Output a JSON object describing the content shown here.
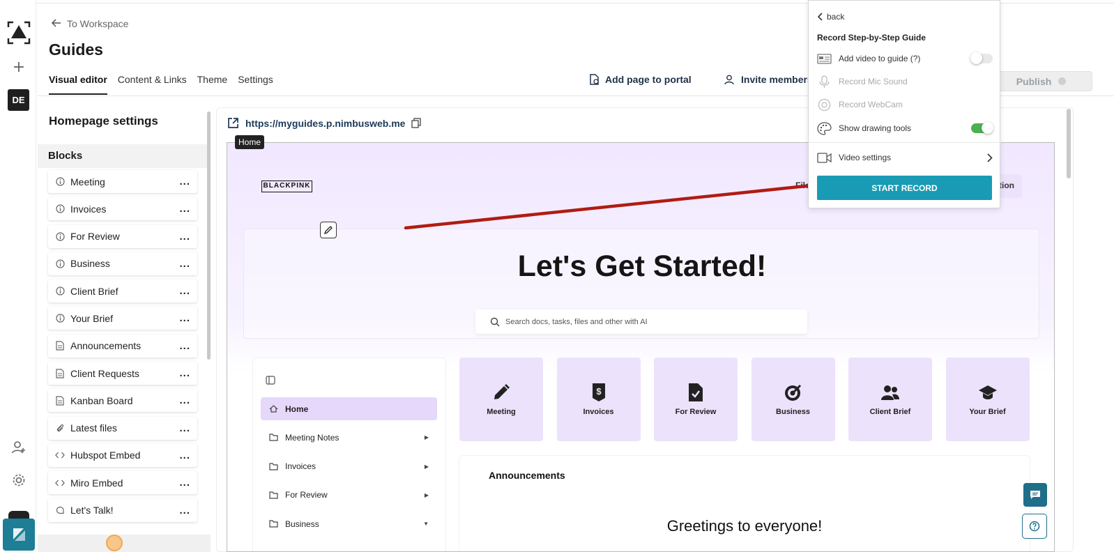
{
  "header": {
    "back_label": "To Workspace",
    "title": "Guides",
    "tabs": [
      {
        "label": "Visual editor",
        "active": true
      },
      {
        "label": "Content & Links",
        "active": false
      },
      {
        "label": "Theme",
        "active": false
      },
      {
        "label": "Settings",
        "active": false
      }
    ],
    "add_page_label": "Add page to portal",
    "invite_label": "Invite members",
    "publish_label": "Publish"
  },
  "rail": {
    "avatar_initials": "DE",
    "plus_symbol": "+",
    "icons": [
      "logo-icon",
      "add-icon",
      "invite-user-icon",
      "settings-gear-icon",
      "app-switch-icon"
    ]
  },
  "settings_panel": {
    "title": "Homepage settings",
    "blocks_label": "Blocks",
    "more_symbol": "...",
    "blocks": [
      {
        "label": "Meeting",
        "icon": "info-icon"
      },
      {
        "label": "Invoices",
        "icon": "info-icon"
      },
      {
        "label": "For Review",
        "icon": "info-icon"
      },
      {
        "label": "Business",
        "icon": "info-icon"
      },
      {
        "label": "Client Brief",
        "icon": "info-icon"
      },
      {
        "label": "Your Brief",
        "icon": "info-icon"
      },
      {
        "label": "Announcements",
        "icon": "document-icon"
      },
      {
        "label": "Client Requests",
        "icon": "document-icon"
      },
      {
        "label": "Kanban Board",
        "icon": "document-icon"
      },
      {
        "label": "Latest files",
        "icon": "paperclip-icon"
      },
      {
        "label": "Hubspot Embed",
        "icon": "code-icon"
      },
      {
        "label": "Miro Embed",
        "icon": "code-icon"
      },
      {
        "label": "Let's Talk!",
        "icon": "chat-icon"
      }
    ]
  },
  "preview": {
    "url": "https://myguides.p.nimbusweb.me",
    "home_tooltip": "Home",
    "logo_text": "BLACKPINK",
    "nav_peek_files": "File",
    "nav_peek_other": "tion",
    "hero_title": "Let's Get Started!",
    "search_placeholder": "Search docs, tasks, files and other with AI",
    "nav_items": [
      {
        "label": "Home",
        "active": true,
        "caret": ""
      },
      {
        "label": "Meeting Notes",
        "active": false,
        "caret": "▶"
      },
      {
        "label": "Invoices",
        "active": false,
        "caret": "▶"
      },
      {
        "label": "For Review",
        "active": false,
        "caret": "▶"
      },
      {
        "label": "Business",
        "active": false,
        "caret": "▼"
      }
    ],
    "tiles": [
      {
        "label": "Meeting",
        "icon": "pencil-icon"
      },
      {
        "label": "Invoices",
        "icon": "dollar-file-icon"
      },
      {
        "label": "For Review",
        "icon": "file-check-icon"
      },
      {
        "label": "Business",
        "icon": "target-icon"
      },
      {
        "label": "Client Brief",
        "icon": "users-icon"
      },
      {
        "label": "Your Brief",
        "icon": "graduation-cap-icon"
      }
    ],
    "announcements_title": "Announcements",
    "greeting": "Greetings to everyone!"
  },
  "recorder": {
    "back_label": "back",
    "title": "Record Step-by-Step Guide",
    "options": [
      {
        "label": "Add video to guide (?)",
        "toggle": "off",
        "disabled": false,
        "icon": "video-card-icon"
      },
      {
        "label": "Record Mic Sound",
        "toggle": "",
        "disabled": true,
        "icon": "microphone-icon"
      },
      {
        "label": "Record WebCam",
        "toggle": "",
        "disabled": true,
        "icon": "webcam-icon"
      },
      {
        "label": "Show drawing tools",
        "toggle": "on",
        "disabled": false,
        "icon": "palette-icon"
      }
    ],
    "video_settings_label": "Video settings",
    "start_label": "START RECORD"
  },
  "colors": {
    "accent": "#1a9bb5",
    "toggle_on": "#4caf50",
    "portal_tile": "#ece2fb",
    "arrow": "#b01c12"
  }
}
